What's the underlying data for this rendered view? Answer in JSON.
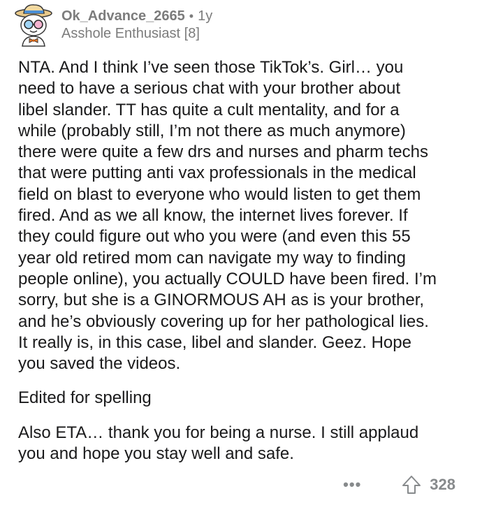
{
  "comment": {
    "username": "Ok_Advance_2665",
    "separator": "•",
    "age": "1y",
    "flair": "Asshole Enthusiast [8]",
    "paragraphs": [
      "NTA. And I think I’ve seen those TikTok’s. Girl… you\nneed to have a serious chat with your brother about\nlibel slander. TT has quite a cult mentality, and for a\nwhile (probably still, I’m not there as much anymore)\nthere were quite a few drs and nurses and pharm techs\nthat were putting anti vax professionals in the medical\nfield on blast to everyone who would listen to get them\nfired. And as we all know, the internet lives forever. If\nthey could figure out who you were (and even this 55\nyear old retired mom can navigate my way to finding\npeople online), you actually COULD have been fired. I’m\nsorry, but she is a GINORMOUS AH as is your brother,\nand he’s obviously covering up for her pathological lies.\nIt really is, in this case, libel and slander. Geez. Hope\nyou saved the videos.",
      "Edited for spelling",
      "Also ETA… thank you for being a nurse. I still applaud\nyou and hope you stay well and safe."
    ],
    "more_label": "•••",
    "upvote_icon": "upvote-arrow-icon",
    "score": "328"
  }
}
